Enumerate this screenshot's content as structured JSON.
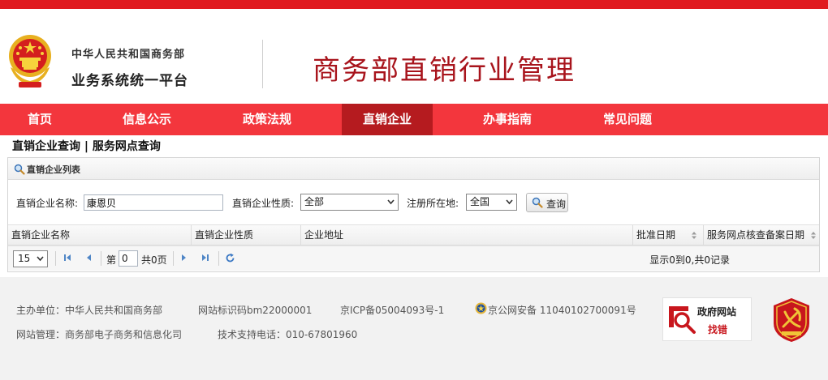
{
  "header": {
    "org_line1": "中华人民共和国商务部",
    "org_line2": "业务系统统一平台",
    "site_title": "商务部直销行业管理"
  },
  "nav": {
    "items": [
      {
        "label": "首页"
      },
      {
        "label": "信息公示"
      },
      {
        "label": "政策法规"
      },
      {
        "label": "直销企业"
      },
      {
        "label": "办事指南"
      },
      {
        "label": "常见问题"
      }
    ],
    "active": "直销企业"
  },
  "breadcrumb": {
    "item1": "直销企业查询",
    "sep": " | ",
    "item2": "服务网点查询"
  },
  "panel": {
    "title": "直销企业列表"
  },
  "search": {
    "name_label": "直销企业名称:",
    "name_value": "康恩贝",
    "nature_label": "直销企业性质:",
    "nature_value": "全部",
    "region_label": "注册所在地:",
    "region_value": "全国",
    "query_button": "查询"
  },
  "table": {
    "columns": [
      "直销企业名称",
      "直销企业性质",
      "企业地址",
      "批准日期",
      "服务网点核查备案日期"
    ],
    "rows": []
  },
  "pager": {
    "page_size": "15",
    "page_prefix": "第",
    "page_value": "0",
    "page_total": "共0页",
    "info": "显示0到0,共0记录"
  },
  "footer": {
    "sponsor": "主办单位：中华人民共和国商务部",
    "site_id": "网站标识码bm22000001",
    "icp": "京ICP备05004093号-1",
    "police": "京公网安备 11040102700091号",
    "admin": "网站管理：商务部电子商务和信息化司",
    "support": "技术支持电话：010-67801960",
    "gov_badge_line1": "政府网站",
    "gov_badge_line2": "找错"
  },
  "colors": {
    "brand_red": "#e01a1f",
    "nav_red": "#f3363d",
    "nav_active": "#b51b1f",
    "title_red": "#a8141c"
  }
}
